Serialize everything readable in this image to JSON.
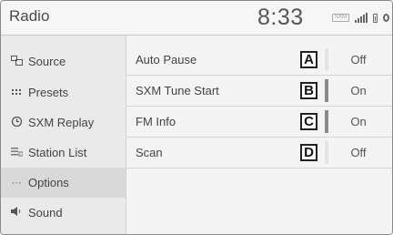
{
  "header": {
    "title": "Radio",
    "clock": "8:33",
    "sxm_badge": "SXM"
  },
  "sidebar": {
    "items": [
      {
        "label": "Source",
        "icon": "ᴟ"
      },
      {
        "label": "Presets",
        "icon": "≡"
      },
      {
        "label": "SXM Replay",
        "icon": "↺"
      },
      {
        "label": "Station List",
        "icon": "☰"
      },
      {
        "label": "Options",
        "icon": "…"
      },
      {
        "label": "Sound",
        "icon": "◀"
      }
    ],
    "active_item": "Options"
  },
  "options": {
    "rows": [
      {
        "label": "Auto Pause",
        "callout": "A",
        "value": "Off",
        "on": false
      },
      {
        "label": "SXM Tune Start",
        "callout": "B",
        "value": "On",
        "on": true
      },
      {
        "label": "FM Info",
        "callout": "C",
        "value": "On",
        "on": true
      },
      {
        "label": "Scan",
        "callout": "D",
        "value": "Off",
        "on": false
      }
    ]
  },
  "colors": {
    "background": "#f3f3f3",
    "sidebar": "#eaeaea",
    "active": "#d9d9d9",
    "indicator_on": "#8a8a8a"
  }
}
